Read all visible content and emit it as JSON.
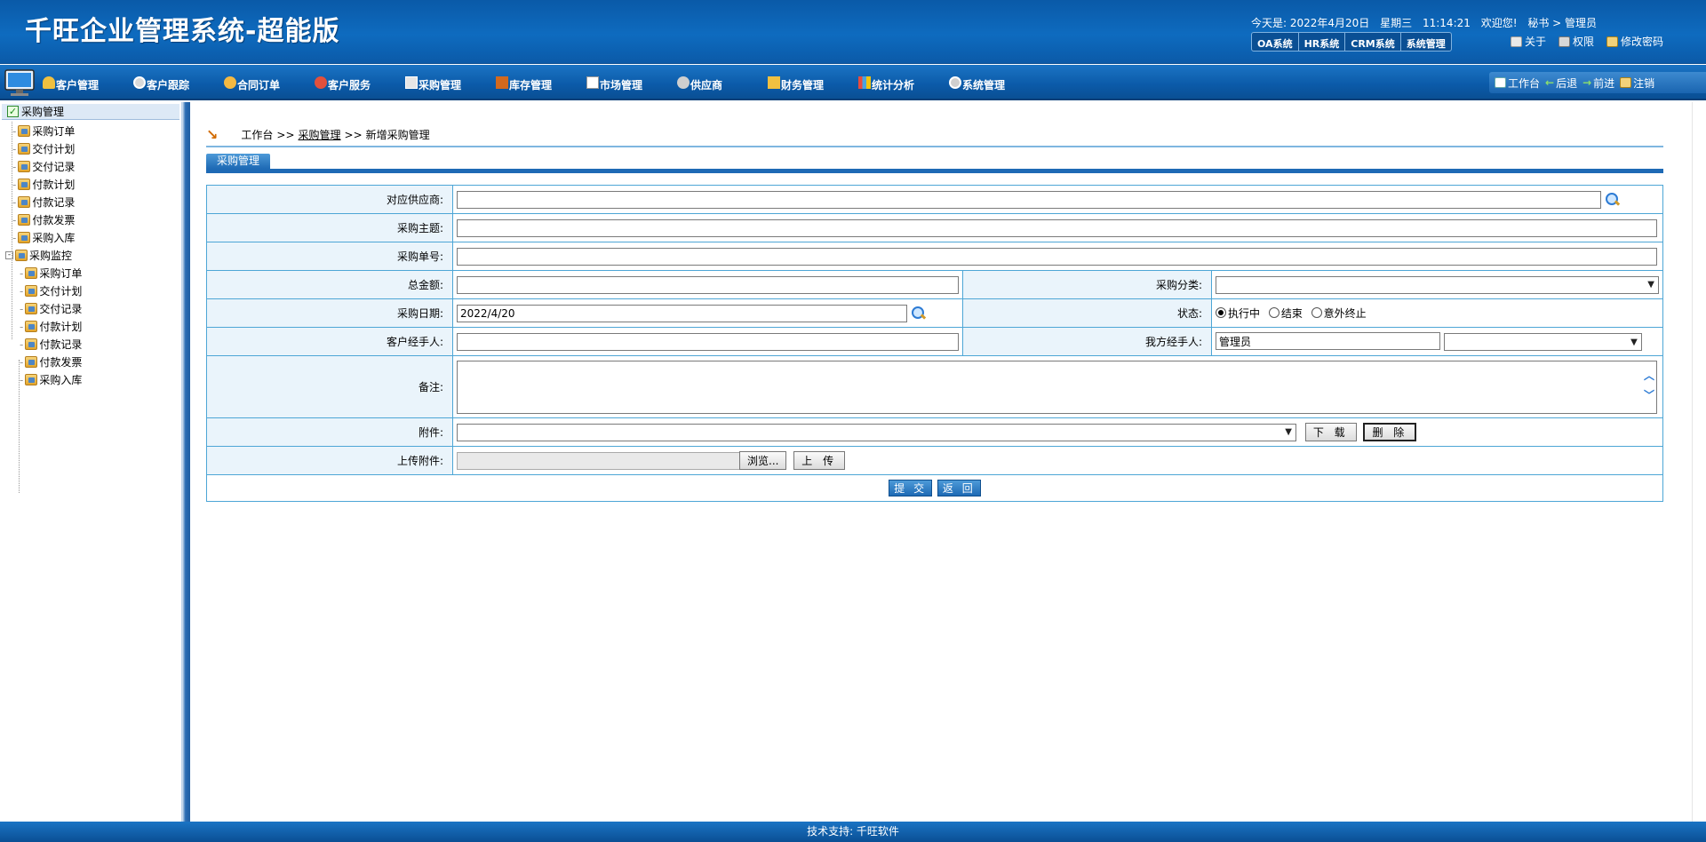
{
  "header": {
    "title": "千旺企业管理系统-超能版",
    "date_text": "今天是: 2022年4月20日",
    "weekday": "星期三",
    "time": "11:14:21",
    "welcome": "欢迎您!",
    "user": "秘书 > 管理员",
    "sys_tabs": [
      "OA系统",
      "HR系统",
      "CRM系统",
      "系统管理"
    ],
    "links": {
      "about": "关于",
      "perm": "权限",
      "change_pwd": "修改密码"
    }
  },
  "menu": {
    "items": [
      "客户管理",
      "客户跟踪",
      "合同订单",
      "客户服务",
      "采购管理",
      "库存管理",
      "市场管理",
      "供应商",
      "财务管理",
      "统计分析",
      "系统管理"
    ],
    "tools": {
      "workbench": "工作台",
      "back": "后退",
      "forward": "前进",
      "logout": "注销"
    }
  },
  "sidebar": {
    "title": "采购管理",
    "items": [
      "采购订单",
      "交付计划",
      "交付记录",
      "付款计划",
      "付款记录",
      "付款发票",
      "采购入库"
    ],
    "monitor_title": "采购监控",
    "monitor_items": [
      "采购订单",
      "交付计划",
      "交付记录",
      "付款计划",
      "付款记录",
      "付款发票",
      "采购入库"
    ]
  },
  "breadcrumb": {
    "home": "工作台",
    "sep": ">>",
    "module": "采购管理",
    "current": "新增采购管理"
  },
  "section_tab": "采购管理",
  "form": {
    "supplier_label": "对应供应商:",
    "subject_label": "采购主题:",
    "order_no_label": "采购单号:",
    "amount_label": "总金额:",
    "category_label": "采购分类:",
    "date_label": "采购日期:",
    "date_value": "2022/4/20",
    "status_label": "状态:",
    "status_options": [
      "执行中",
      "结束",
      "意外终止"
    ],
    "status_selected": "执行中",
    "client_handler_label": "客户经手人:",
    "our_handler_label": "我方经手人:",
    "our_handler_value": "管理员",
    "remark_label": "备注:",
    "attachment_label": "附件:",
    "download_btn": "下 载",
    "delete_btn": "删 除",
    "upload_label": "上传附件:",
    "browse_btn": "浏览...",
    "upload_btn": "上 传",
    "submit_btn": "提 交",
    "back_btn": "返 回"
  },
  "footer": "技术支持: 千旺软件"
}
